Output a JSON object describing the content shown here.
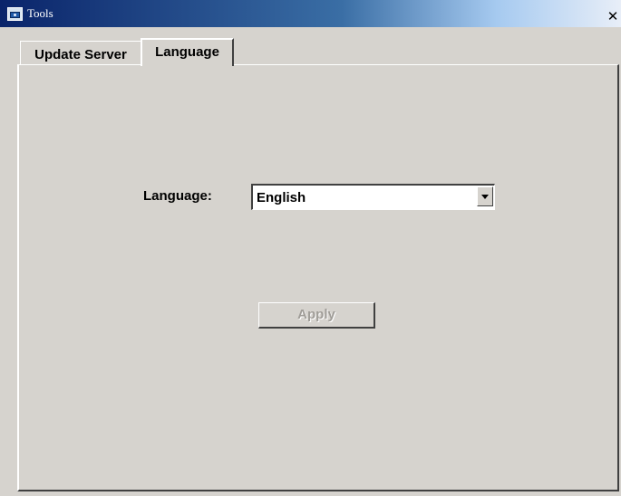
{
  "window": {
    "title": "Tools",
    "close_glyph": "✕",
    "icon": "app-window-icon"
  },
  "tabs": [
    {
      "label": "Update Server",
      "active": false
    },
    {
      "label": "Language",
      "active": true
    }
  ],
  "language_tab": {
    "language_label": "Language:",
    "language_select": {
      "selected": "English"
    },
    "apply_label": "Apply",
    "apply_enabled": false
  },
  "colors": {
    "titlebar_start": "#0a246a",
    "titlebar_end": "#a6caf0",
    "face": "#d6d3ce",
    "disabled_text": "#a09d98"
  }
}
